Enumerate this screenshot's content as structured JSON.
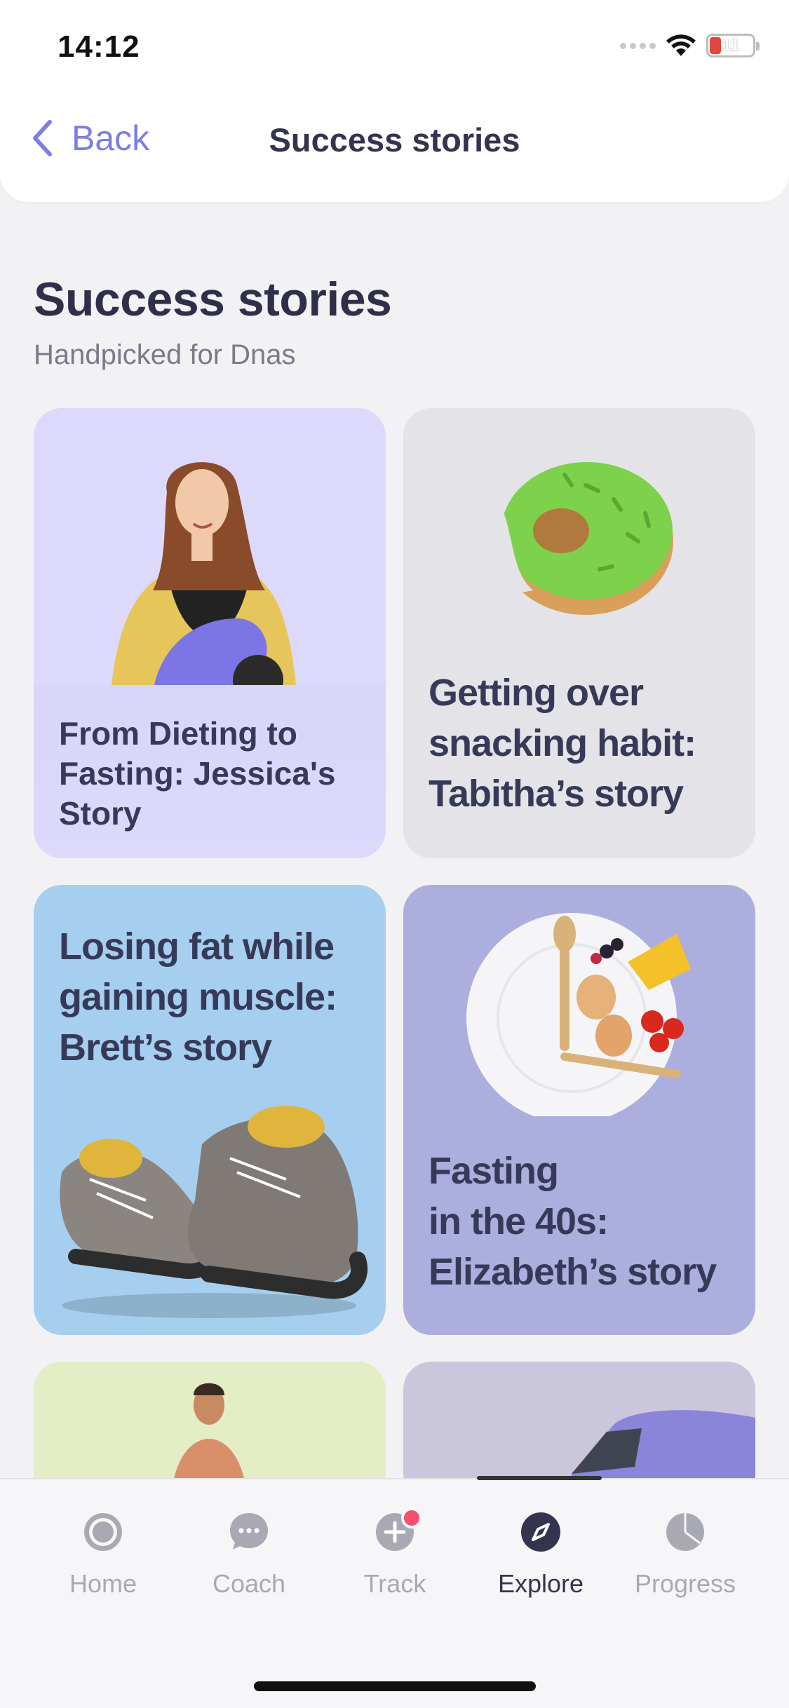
{
  "status_bar": {
    "time": "14:12",
    "battery": "11"
  },
  "header": {
    "back_label": "Back",
    "title": "Success stories"
  },
  "section": {
    "title": "Success stories",
    "subtitle": "Handpicked for Dnas"
  },
  "cards": [
    {
      "title_lines": [
        "From Dieting to",
        "Fasting: Jessica's",
        "Story"
      ]
    },
    {
      "title_lines": [
        "Getting over",
        "snacking habit:",
        "Tabitha’s story"
      ]
    },
    {
      "title_lines": [
        "Losing fat while",
        "gaining muscle:",
        "Brett’s story"
      ]
    },
    {
      "title_lines": [
        "Fasting",
        "in the 40s:",
        "Elizabeth’s story"
      ]
    }
  ],
  "tabbar": {
    "tabs": [
      {
        "label": "Home",
        "icon": "home-icon"
      },
      {
        "label": "Coach",
        "icon": "chat-icon"
      },
      {
        "label": "Track",
        "icon": "plus-icon"
      },
      {
        "label": "Explore",
        "icon": "compass-icon"
      },
      {
        "label": "Progress",
        "icon": "pie-chart-icon"
      }
    ],
    "active": "Explore"
  },
  "colors": {
    "accent": "#7b7fe3",
    "text_dark": "#2f2f4a",
    "badge": "#f2506d"
  }
}
